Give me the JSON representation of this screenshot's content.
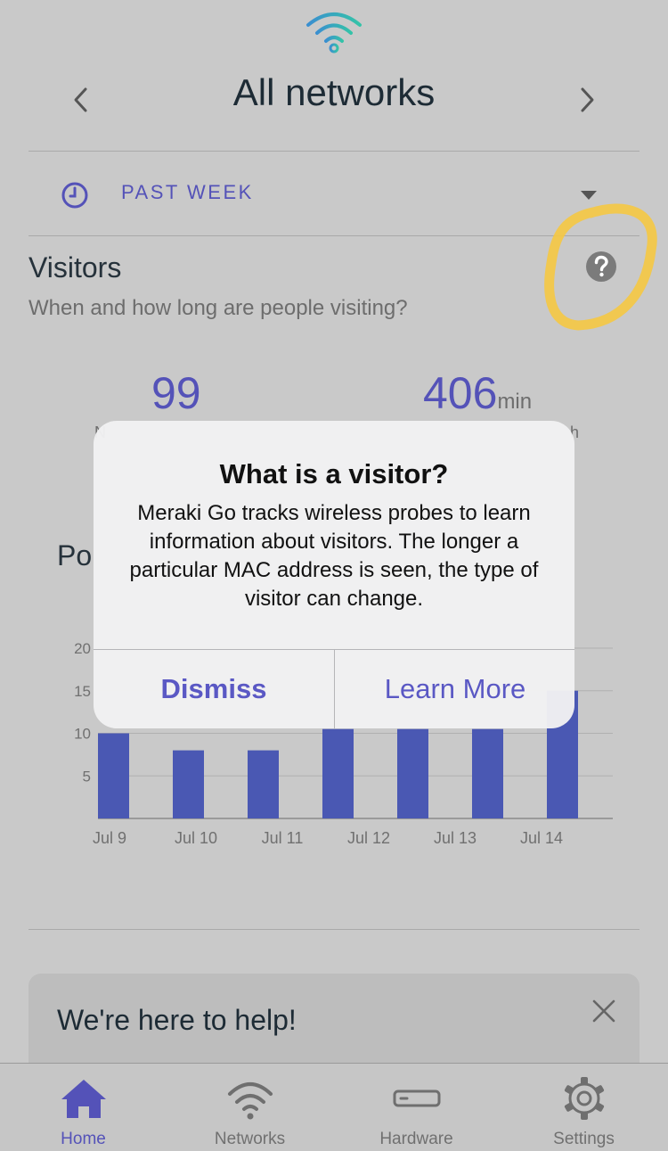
{
  "header": {
    "title": "All networks",
    "prev_icon": "chevron-left-icon",
    "next_icon": "chevron-right-icon",
    "logo_icon": "wifi-logo-icon"
  },
  "time_range": {
    "label": "PAST WEEK",
    "icon": "clock-icon",
    "dropdown_icon": "caret-down-icon"
  },
  "visitors": {
    "title": "Visitors",
    "subtitle": "When and how long are people visiting?",
    "help_icon": "question-mark-icon",
    "stats": [
      {
        "value": "99",
        "unit": "",
        "label_fragment": "N"
      },
      {
        "value": "406",
        "unit": "min",
        "label_fragment": "h"
      }
    ]
  },
  "partial_section_title": "Po",
  "chart_data": {
    "type": "bar",
    "categories": [
      "Jul 9",
      "",
      "Jul 10",
      "",
      "Jul 11",
      "",
      "Jul 12",
      "",
      "Jul 13",
      "",
      "Jul 14",
      ""
    ],
    "x_tick_labels": [
      "Jul 9",
      "Jul 10",
      "Jul 11",
      "Jul 12",
      "Jul 13",
      "Jul 14"
    ],
    "visible_values": [
      10,
      8,
      8,
      10.5,
      10.5,
      10.5,
      15
    ],
    "y_ticks": [
      5,
      10,
      15,
      20
    ],
    "ylim": [
      0,
      20
    ],
    "bar_color": "#4a58b3",
    "grid": true
  },
  "help_card": {
    "title": "We're here to help!",
    "close_icon": "close-icon"
  },
  "tabbar": {
    "tabs": [
      {
        "label": "Home",
        "icon": "home-icon",
        "active": true
      },
      {
        "label": "Networks",
        "icon": "wifi-icon",
        "active": false
      },
      {
        "label": "Hardware",
        "icon": "hardware-device-icon",
        "active": false
      },
      {
        "label": "Settings",
        "icon": "gear-icon",
        "active": false
      }
    ]
  },
  "alert": {
    "title": "What is a visitor?",
    "message": "Meraki Go tracks wireless probes to learn information about visitors. The longer a particular MAC address is seen, the type of visitor can change.",
    "buttons": {
      "dismiss": "Dismiss",
      "learn_more": "Learn More"
    }
  },
  "colors": {
    "accent": "#5452b8",
    "highlight": "#f5c842",
    "background": "#c9c9c9"
  }
}
